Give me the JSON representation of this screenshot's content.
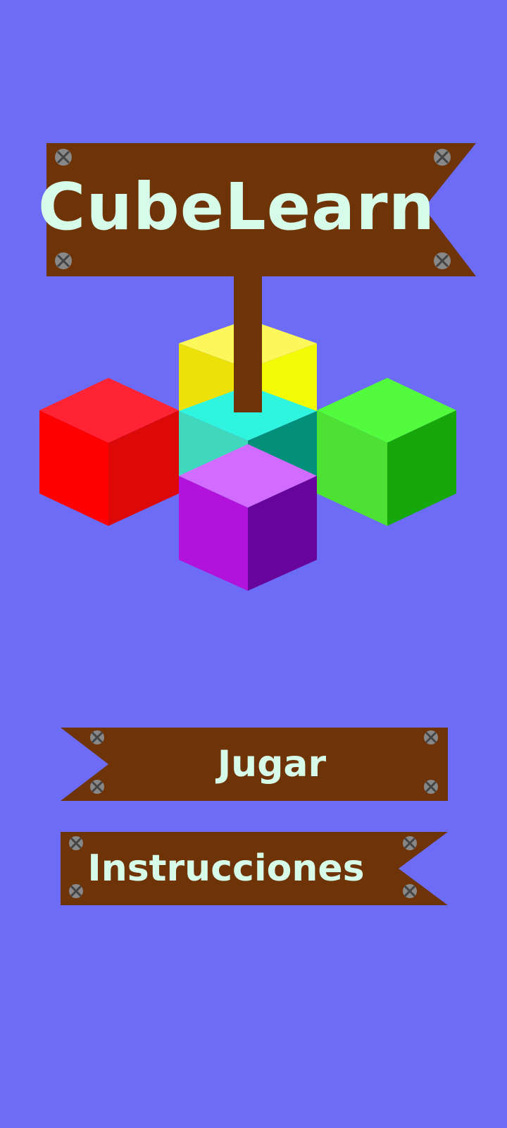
{
  "app": {
    "title": "CubeLearn"
  },
  "menu": {
    "play_label": "Jugar",
    "instructions_label": "Instrucciones"
  },
  "colors": {
    "background": "#6c6cf7",
    "sign_wood": "#6e3306",
    "sign_text": "#d6fbe9",
    "screw": "#8a8a8a",
    "cube_red": "#ff2030",
    "cube_yellow": "#ffff55",
    "cube_cyan": "#2ff5de",
    "cube_green": "#52fb3c",
    "cube_purple": "#d26bff"
  },
  "icons": {
    "logo": "stacked-cubes-logo",
    "screw": "screw-icon"
  }
}
